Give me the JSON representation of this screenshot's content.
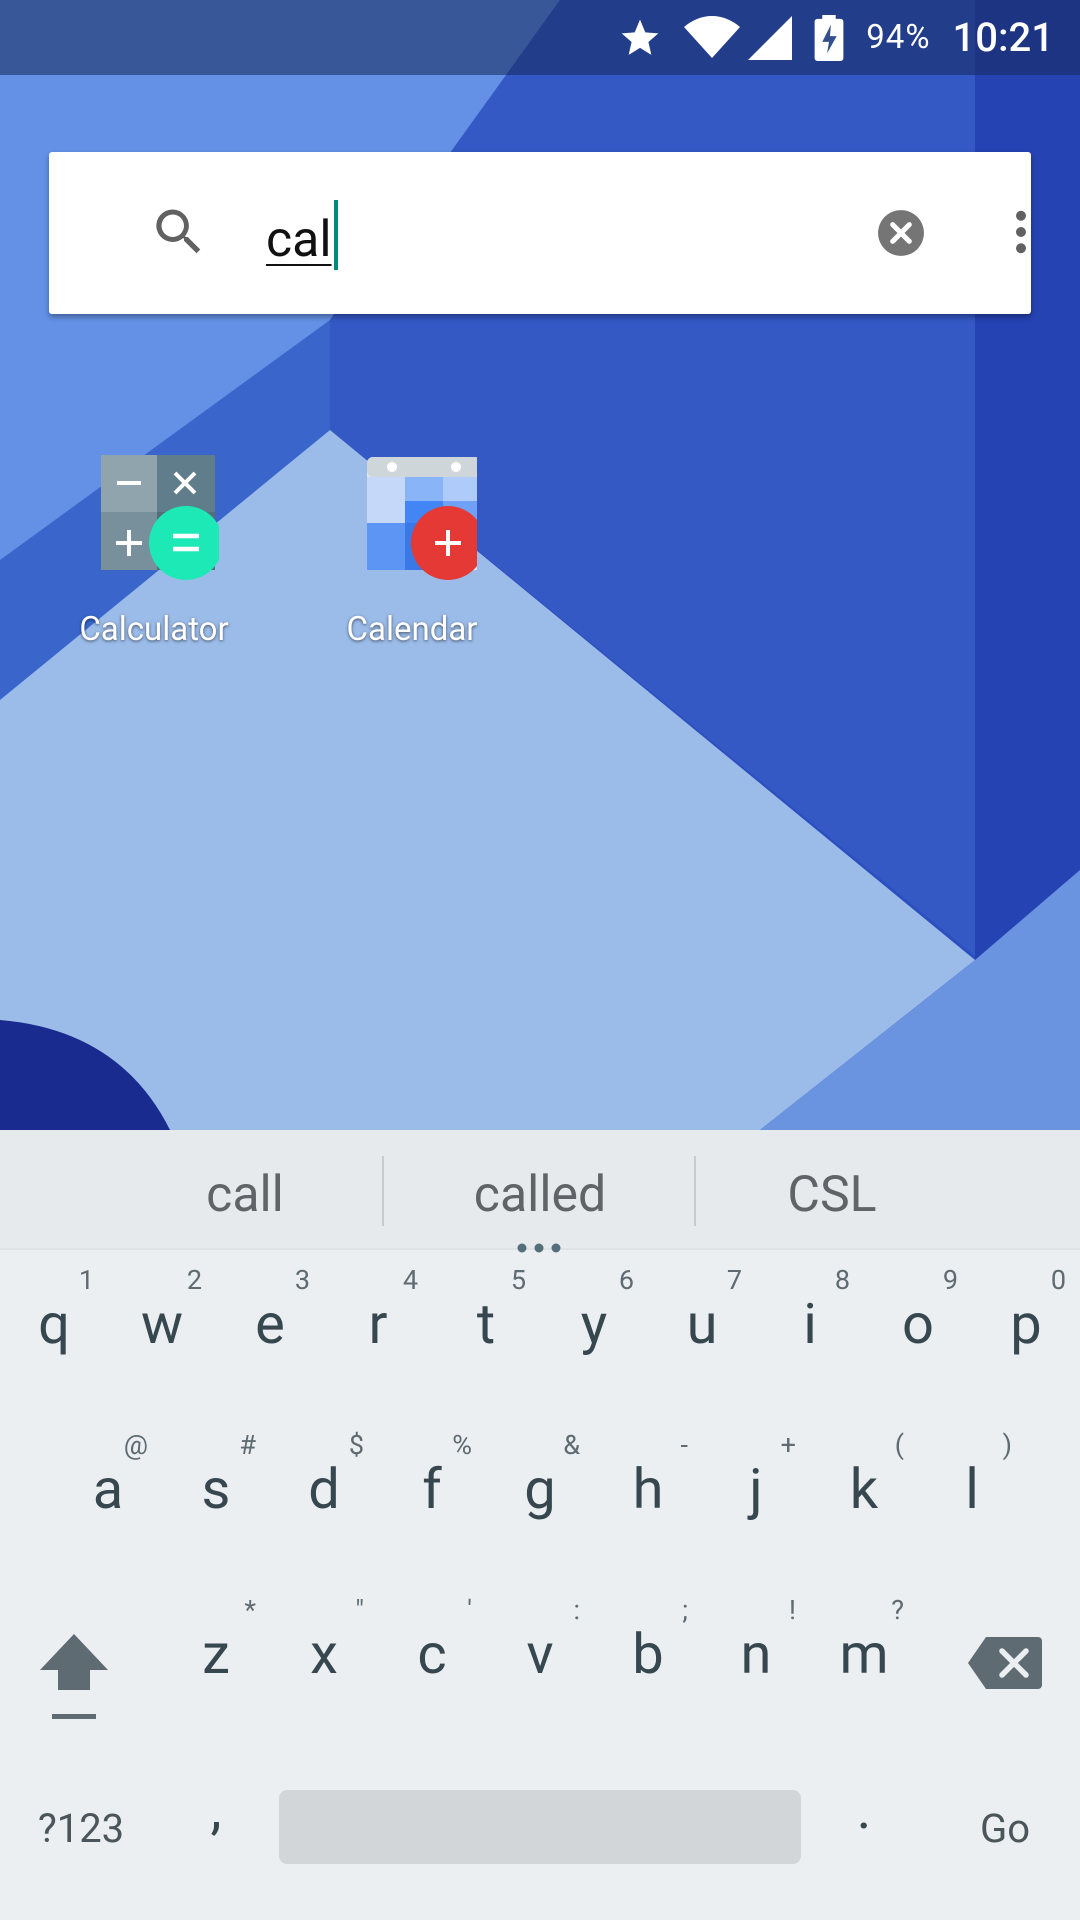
{
  "status_bar": {
    "icons": [
      "star-icon",
      "wifi-icon",
      "cell-signal-icon",
      "battery-charging-icon"
    ],
    "battery_percent": "94%",
    "time": "10:21"
  },
  "search": {
    "query": "cal",
    "icons": [
      "search-icon",
      "clear-icon",
      "more-vert-icon"
    ]
  },
  "apps": [
    {
      "label": "Calculator",
      "icon": "calculator-icon",
      "accent": "#1de9b6"
    },
    {
      "label": "Calendar",
      "icon": "calendar-icon",
      "accent": "#e53935"
    }
  ],
  "keyboard": {
    "suggestions": [
      "call",
      "called",
      "CSL"
    ],
    "row1": [
      {
        "key": "q",
        "hint": "1"
      },
      {
        "key": "w",
        "hint": "2"
      },
      {
        "key": "e",
        "hint": "3"
      },
      {
        "key": "r",
        "hint": "4"
      },
      {
        "key": "t",
        "hint": "5"
      },
      {
        "key": "y",
        "hint": "6"
      },
      {
        "key": "u",
        "hint": "7"
      },
      {
        "key": "i",
        "hint": "8"
      },
      {
        "key": "o",
        "hint": "9"
      },
      {
        "key": "p",
        "hint": "0"
      }
    ],
    "row2": [
      {
        "key": "a",
        "hint": "@"
      },
      {
        "key": "s",
        "hint": "#"
      },
      {
        "key": "d",
        "hint": "$"
      },
      {
        "key": "f",
        "hint": "%"
      },
      {
        "key": "g",
        "hint": "&"
      },
      {
        "key": "h",
        "hint": "-"
      },
      {
        "key": "j",
        "hint": "+"
      },
      {
        "key": "k",
        "hint": "("
      },
      {
        "key": "l",
        "hint": ")"
      }
    ],
    "row3": [
      {
        "key": "z",
        "hint": "*"
      },
      {
        "key": "x",
        "hint": "\""
      },
      {
        "key": "c",
        "hint": "'"
      },
      {
        "key": "v",
        "hint": ":"
      },
      {
        "key": "b",
        "hint": ";"
      },
      {
        "key": "n",
        "hint": "!"
      },
      {
        "key": "m",
        "hint": "?"
      }
    ],
    "symbols_key": "?123",
    "comma_key": ",",
    "period_key": ".",
    "action_key": "Go"
  }
}
